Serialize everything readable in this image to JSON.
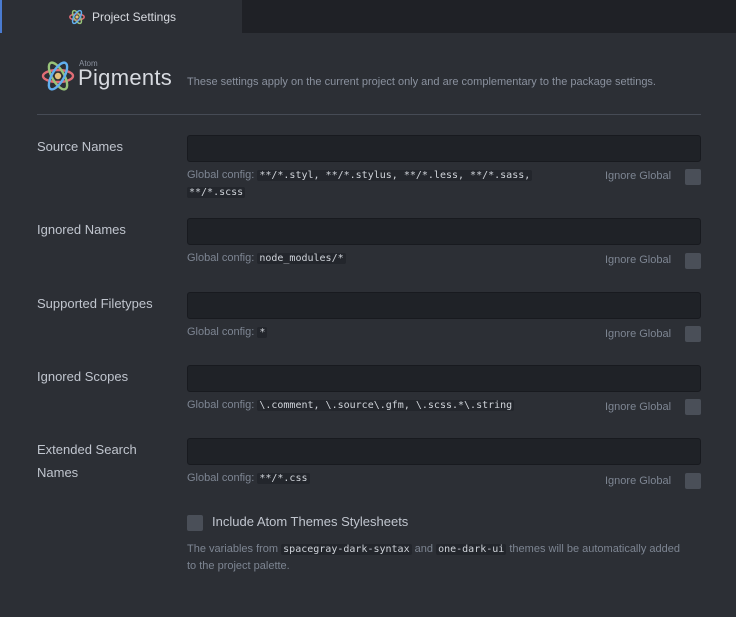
{
  "tab": {
    "title": "Project Settings",
    "icon": "pigments-logo-icon"
  },
  "header": {
    "brand_small": "Atom",
    "brand_name": "Pigments",
    "description": "These settings apply on the current project only and are complementary to the package settings."
  },
  "global_prefix": "Global config:",
  "ignore_global_label": "Ignore Global",
  "settings": [
    {
      "label": "Source Names",
      "value": "",
      "global_line1": "**/*.styl, **/*.stylus, **/*.less, **/*.sass,",
      "global_line2": "**/*.scss",
      "ignore_global": false
    },
    {
      "label": "Ignored Names",
      "value": "",
      "global": "node_modules/*",
      "ignore_global": false
    },
    {
      "label": "Supported Filetypes",
      "value": "",
      "global": "*",
      "ignore_global": false
    },
    {
      "label": "Ignored Scopes",
      "value": "",
      "global": "\\.comment, \\.source\\.gfm, \\.scss.*\\.string",
      "ignore_global": false
    },
    {
      "label_line1": "Extended Search",
      "label_line2": "Names",
      "value": "",
      "global": "**/*.css",
      "ignore_global": false
    }
  ],
  "include_themes": {
    "label": "Include Atom Themes Stylesheets",
    "checked": false,
    "note_prefix": "The variables from",
    "theme1": "spacegray-dark-syntax",
    "note_and": "and",
    "theme2": "one-dark-ui",
    "note_suffix": "themes will be automatically added to the project palette."
  }
}
